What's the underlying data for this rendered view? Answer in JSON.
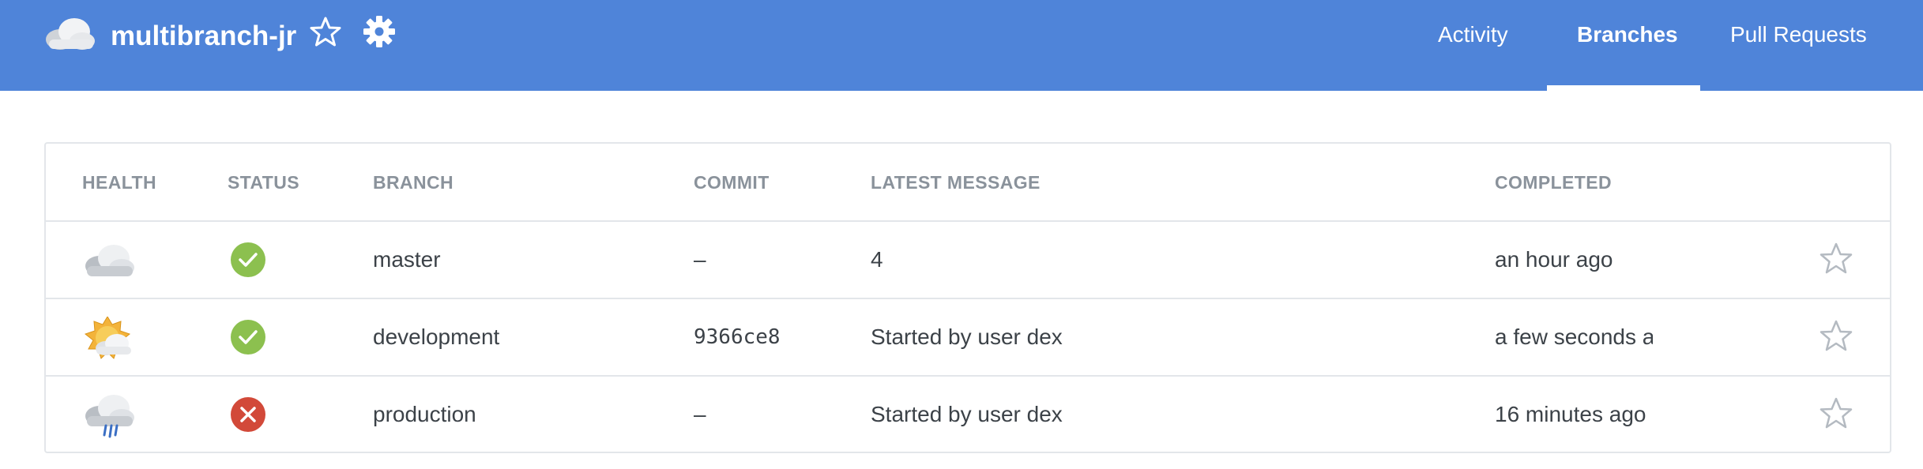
{
  "header": {
    "project_name": "multibranch-jr",
    "tabs": [
      {
        "label": "Activity",
        "active": false
      },
      {
        "label": "Branches",
        "active": true
      },
      {
        "label": "Pull Requests",
        "active": false
      }
    ]
  },
  "table": {
    "columns": [
      "HEALTH",
      "STATUS",
      "BRANCH",
      "COMMIT",
      "LATEST MESSAGE",
      "COMPLETED"
    ],
    "rows": [
      {
        "health": "cloudy-icon",
        "status": "success",
        "branch": "master",
        "commit": "–",
        "message": "4",
        "completed": "an hour ago"
      },
      {
        "health": "partly-sunny-icon",
        "status": "success",
        "branch": "development",
        "commit": "9366ce8",
        "message": "Started by user dex",
        "completed": "a few seconds ago"
      },
      {
        "health": "rain-icon",
        "status": "failure",
        "branch": "production",
        "commit": "–",
        "message": "Started by user dex",
        "completed": "16 minutes ago"
      }
    ]
  },
  "colors": {
    "header_bg": "#4f84d9",
    "success": "#8cc04f",
    "failure": "#d24939",
    "header_text": "#8a929b"
  }
}
